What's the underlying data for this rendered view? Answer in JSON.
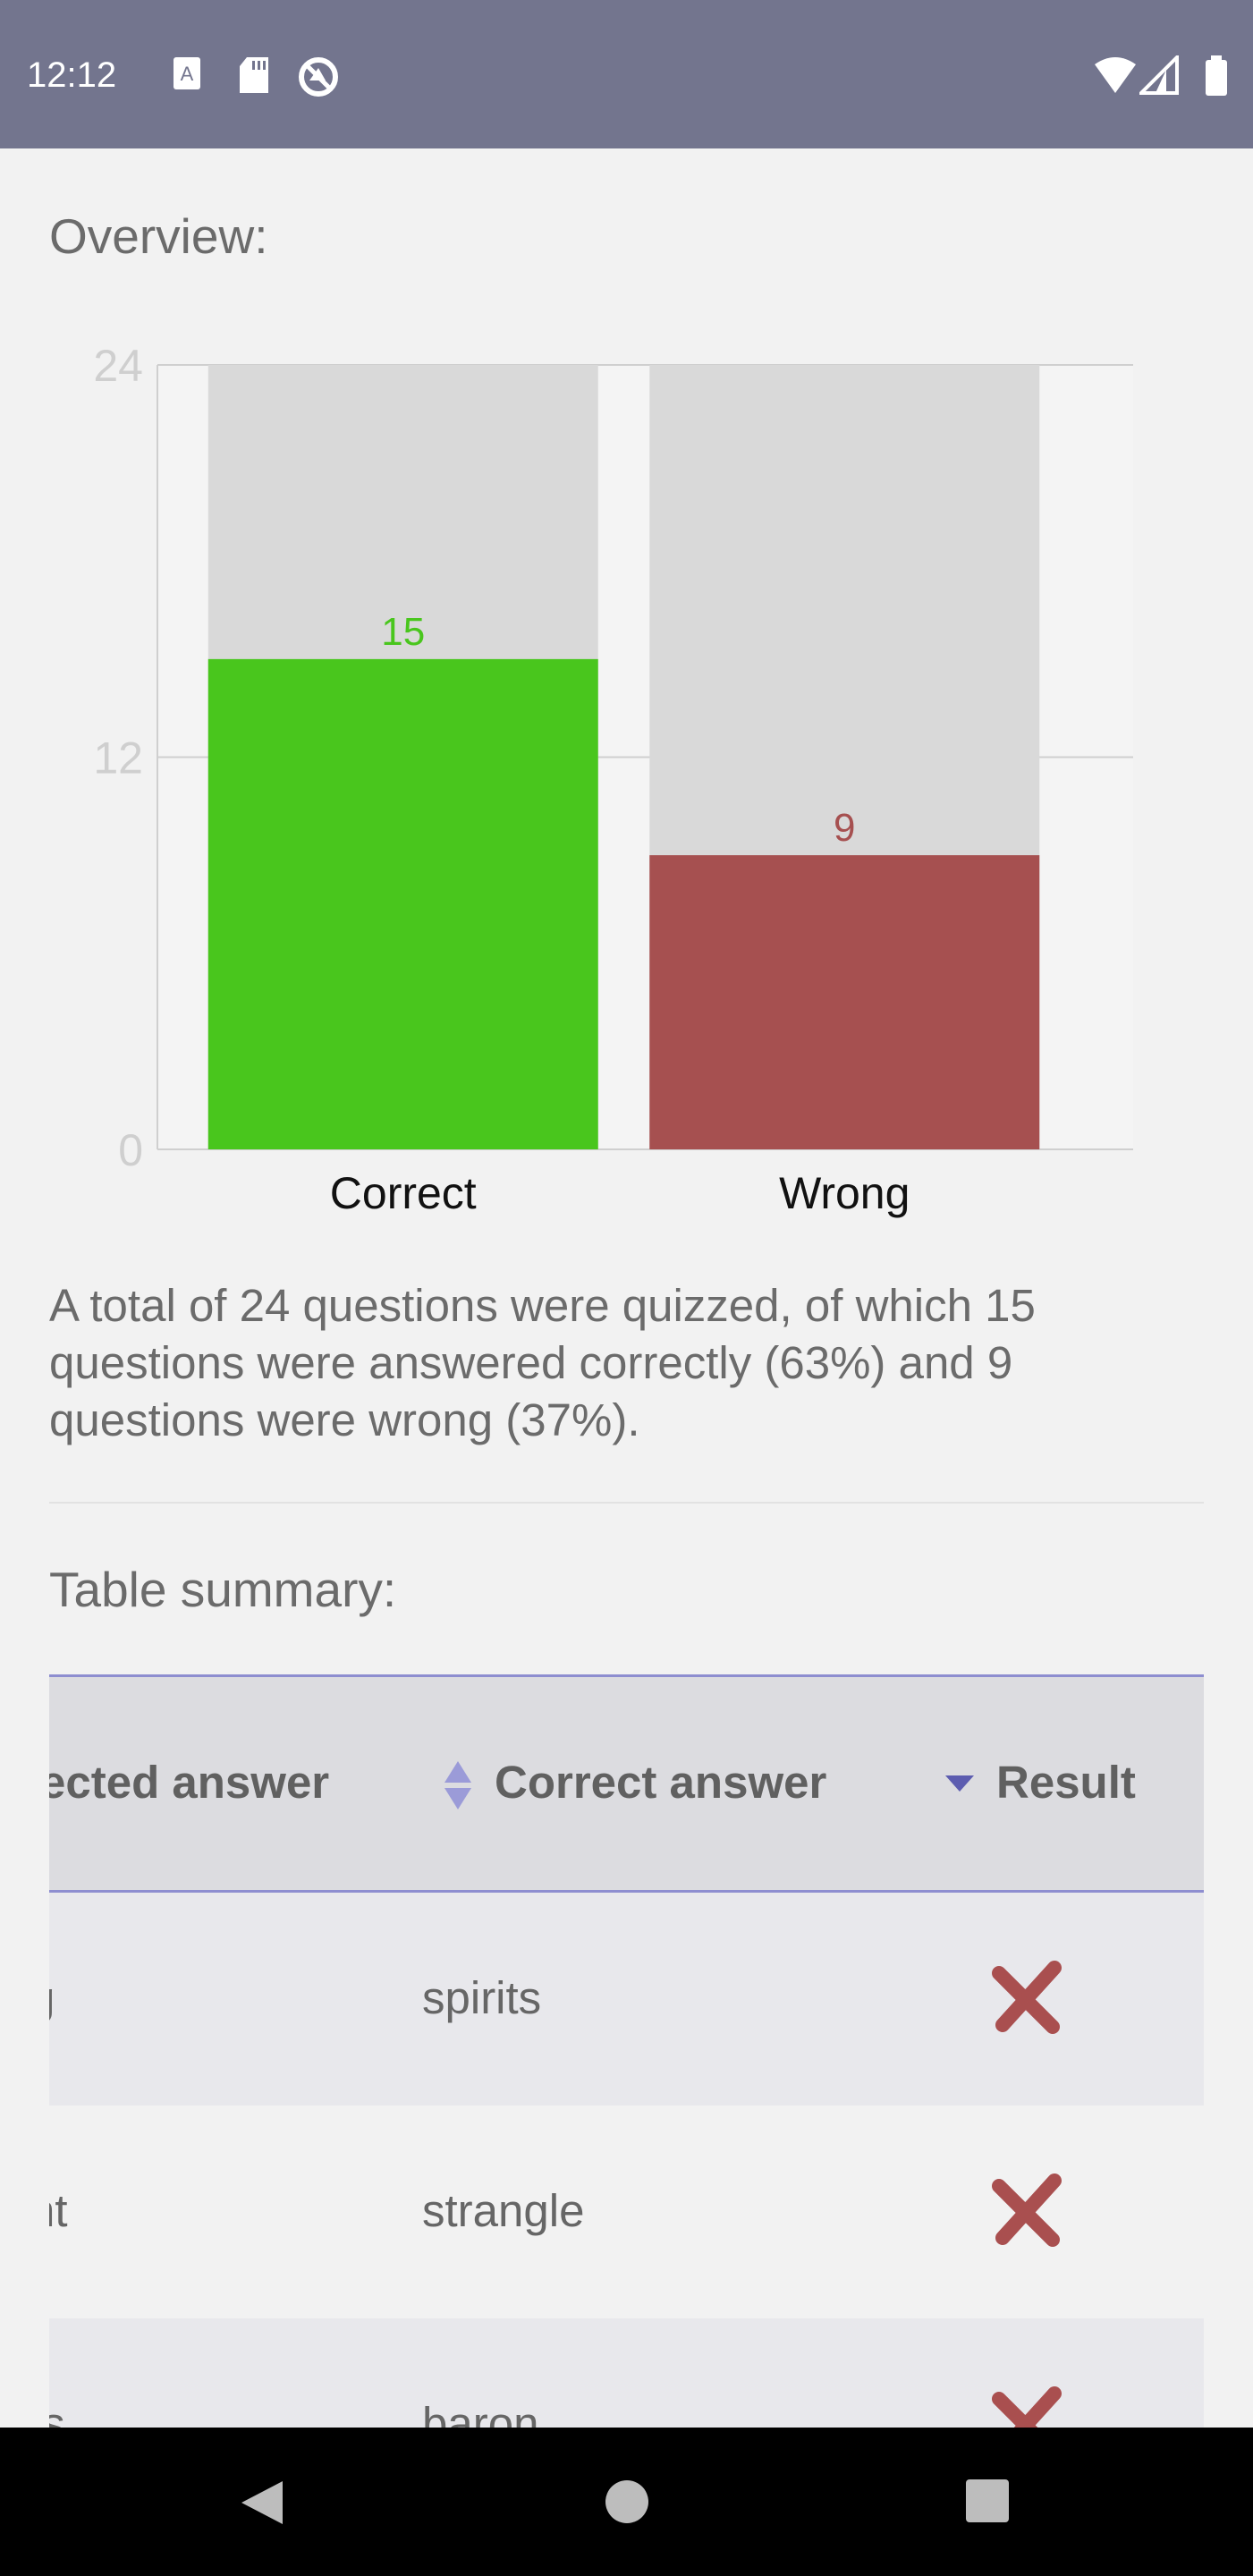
{
  "status_bar": {
    "time": "12:12",
    "icons": [
      "font-a-icon",
      "sd-card-icon",
      "no-sync-icon",
      "wifi-icon",
      "signal-icon",
      "battery-icon"
    ]
  },
  "overview": {
    "heading": "Overview:"
  },
  "chart_data": {
    "type": "bar",
    "categories": [
      "Correct",
      "Wrong"
    ],
    "values": [
      15,
      9
    ],
    "total": 24,
    "colors": [
      "#49c61d",
      "#a65050"
    ],
    "background_bar_color": "#d9d9d9",
    "ylim": [
      0,
      24
    ],
    "yticks": [
      0,
      12,
      24
    ],
    "data_labels": [
      "15",
      "9"
    ],
    "grid": true,
    "title": "",
    "xlabel": "",
    "ylabel": ""
  },
  "summary": "A total of 24 questions were quizzed, of which 15 questions were answered correctly (63%) and 9 questions were wrong (37%).",
  "table": {
    "heading": "Table summary:",
    "columns": [
      "ected answer",
      "Correct answer",
      "Result"
    ],
    "rows": [
      {
        "selected": "g",
        "correct": "spirits",
        "result": "wrong"
      },
      {
        "selected": "nt",
        "correct": "strangle",
        "result": "wrong"
      },
      {
        "selected": "ts",
        "correct": "baron",
        "result": "wrong"
      }
    ]
  },
  "nav": {
    "icons": [
      "back-icon",
      "home-icon",
      "recents-icon"
    ]
  }
}
